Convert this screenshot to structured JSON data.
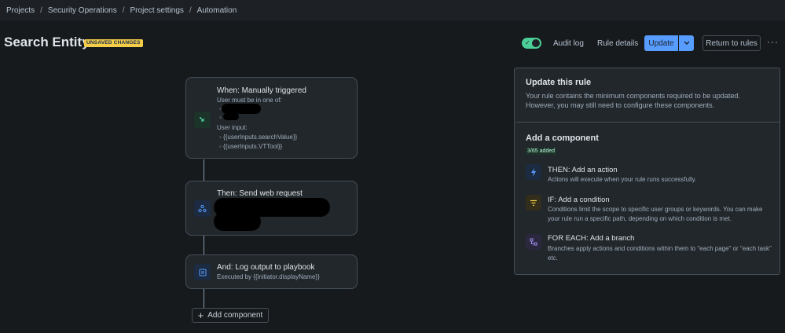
{
  "breadcrumb": [
    "Projects",
    "Security Operations",
    "Project settings",
    "Automation"
  ],
  "breadcrumb_sep": "/",
  "header": {
    "title": "Search Entity",
    "badge": "UNSAVED CHANGES",
    "audit_log": "Audit log",
    "rule_details": "Rule details",
    "update": "Update",
    "return": "Return to rules",
    "more": "···"
  },
  "flow": {
    "trigger": {
      "title": "When: Manually triggered",
      "line1": "User must be in one of:",
      "bullet1": "◦",
      "bullet2": "◦",
      "line2": "User input:",
      "input1": "◦  {{userInputs.searchValue}}",
      "input2": "◦  {{userInputs.VTTool}}"
    },
    "action1": {
      "title": "Then: Send web request"
    },
    "action2": {
      "title": "And: Log output to playbook",
      "sub": "Executed by {{initiator.displayName}}"
    },
    "add_component": "Add component"
  },
  "panel": {
    "title": "Update this rule",
    "desc": "Your rule contains the minimum components required to be updated. However, you may still need to configure these components.",
    "add_title": "Add a component",
    "added": "3/65 added",
    "options": [
      {
        "title": "THEN: Add an action",
        "desc": "Actions will execute when your rule runs successfully."
      },
      {
        "title": "IF: Add a condition",
        "desc": "Conditions limit the scope to specific user groups or keywords. You can make your rule run a specific path, depending on which condition is met."
      },
      {
        "title": "FOR EACH: Add a branch",
        "desc": "Branches apply actions and conditions within them to \"each page\" or \"each task\" etc."
      }
    ]
  },
  "colors": {
    "accent": "#579dff",
    "badge": "#f5cd47",
    "toggle": "#4bce97",
    "trigger_icon": "#4bce97",
    "action_icon": "#579dff",
    "condition_icon": "#f5cd47",
    "branch_icon": "#9f8fef"
  }
}
